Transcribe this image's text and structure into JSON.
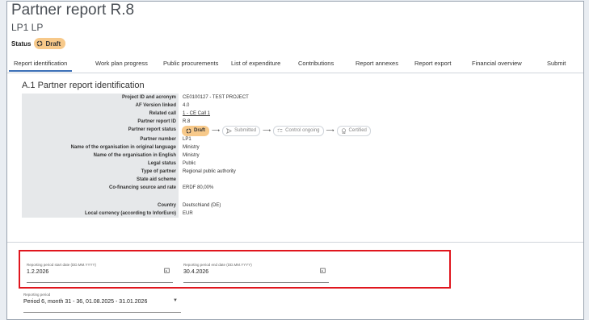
{
  "header": {
    "title": "Partner report R.8",
    "subtitle": "LP1 LP",
    "status_label": "Status",
    "status_value": "Draft"
  },
  "tabs": [
    {
      "label": "Report identification",
      "active": true
    },
    {
      "label": "Work plan progress"
    },
    {
      "label": "Public procurements"
    },
    {
      "label": "List of expenditure"
    },
    {
      "label": "Contributions"
    },
    {
      "label": "Report annexes"
    },
    {
      "label": "Report export"
    },
    {
      "label": "Financial overview"
    },
    {
      "label": "Submit"
    }
  ],
  "section": {
    "title": "A.1 Partner report identification"
  },
  "rows": [
    {
      "label": "Project ID and acronym",
      "value": "CE0100127 - TEST PROJECT"
    },
    {
      "label": "AF Version linked",
      "value": "4.0"
    },
    {
      "label": "Related call",
      "value": "1 - CE Call 1"
    },
    {
      "label": "Partner report ID",
      "value": "R.8"
    },
    {
      "label": "Partner report status",
      "value": ""
    },
    {
      "label": "Partner number",
      "value": "LP1"
    },
    {
      "label": "Name of the organisation in original language",
      "value": "Ministry"
    },
    {
      "label": "Name of the organisation in English",
      "value": "Ministry"
    },
    {
      "label": "Legal status",
      "value": "Public"
    },
    {
      "label": "Type of partner",
      "value": "Regional public authority"
    },
    {
      "label": "State aid scheme",
      "value": ""
    },
    {
      "label": "Co-financing source and rate",
      "value": "ERDF 80,00%"
    },
    {
      "label": "Country",
      "value": "Deutschland (DE)"
    },
    {
      "label": "Local currency (according to InforEuro)",
      "value": "EUR"
    }
  ],
  "status_steps": [
    "Draft",
    "Submitted",
    "Control ongoing",
    "Certified"
  ],
  "form": {
    "start_label": "Reporting period start date (DD.MM.YYYY)",
    "start_value": "1.2.2026",
    "end_label": "Reporting period end date (DD.MM.YYYY)",
    "end_value": "30.4.2026",
    "period_label": "Reporting period",
    "period_value": "Period 6, month 31 - 36, 01.08.2025 - 31.01.2026"
  },
  "colors": {
    "accent": "#3b6fb6",
    "draft": "#f7c98a",
    "highlight": "#e0161e"
  }
}
